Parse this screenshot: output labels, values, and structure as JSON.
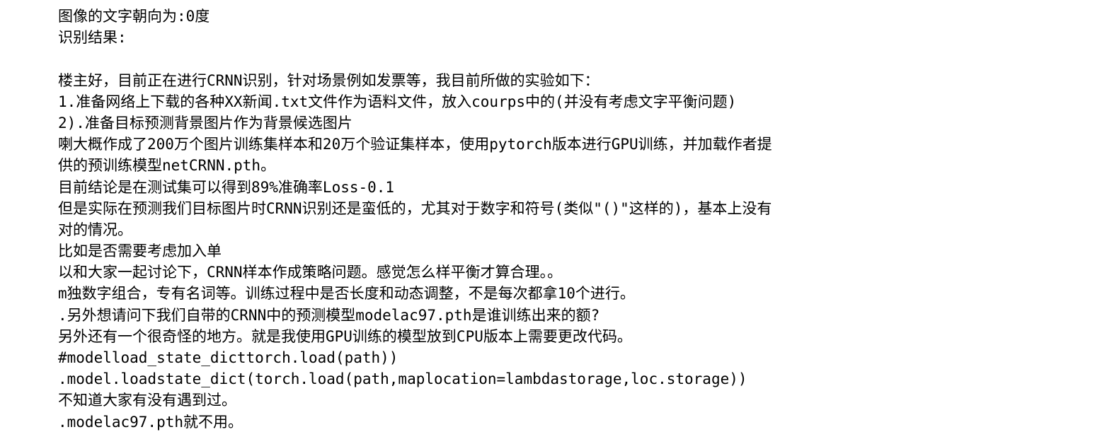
{
  "header": {
    "orientation": "图像的文字朝向为:0度",
    "result_label": "识别结果:"
  },
  "lines": [
    "楼主好，目前正在进行CRNN识别，针对场景例如发票等，我目前所做的实验如下：",
    "1.准备网络上下载的各种XX新闻.txt文件作为语料文件，放入courps中的(并没有考虑文字平衡问题)",
    "2).准备目标预测背景图片作为背景候选图片",
    "喇大概作成了200万个图片训练集样本和20万个验证集样本，使用pytorch版本进行GPU训练，并加载作者提",
    "供的预训练模型netCRNN.pth。",
    "目前结论是在测试集可以得到89%准确率Loss-0.1",
    "但是实际在预测我们目标图片时CRNN识别还是蛮低的，尤其对于数字和符号(类似\"()\"这样的)，基本上没有",
    "对的情况。",
    "比如是否需要考虑加入单",
    "以和大家一起讨论下，CRNN样本作成策略问题。感觉怎么样平衡才算合理。。",
    "m独数字组合，专有名词等。训练过程中是否长度和动态调整，不是每次都拿10个进行。",
    ".另外想请问下我们自带的CRNN中的预测模型modelac97.pth是谁训练出来的额?",
    "另外还有一个很奇怪的地方。就是我使用GPU训练的模型放到CPU版本上需要更改代码。",
    "#modelload_state_dicttorch.load(path))",
    ".model.loadstate_dict(torch.load(path,maplocation=lambdastorage,loc.storage))",
    "不知道大家有没有遇到过。",
    ".modelac97.pth就不用。"
  ]
}
